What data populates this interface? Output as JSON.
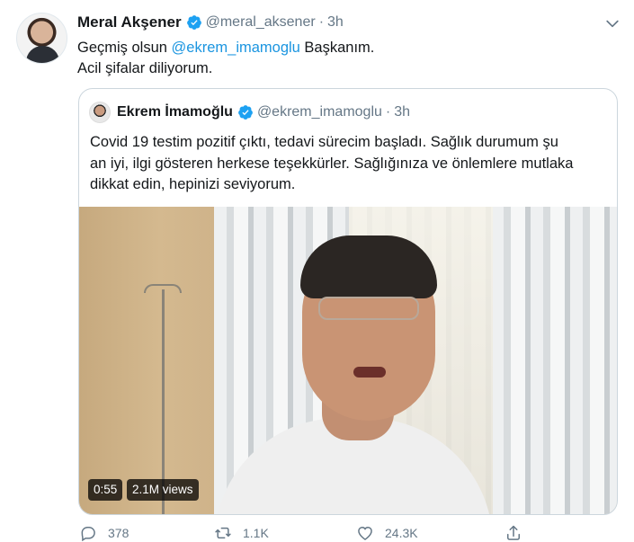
{
  "tweet": {
    "author": {
      "display_name": "Meral Akşener",
      "handle": "@meral_aksener",
      "time": "3h"
    },
    "text_line1_before": "Geçmiş olsun ",
    "text_line1_mention": "@ekrem_imamoglu",
    "text_line1_after": " Başkanım.",
    "text_line2": "Acil şifalar diliyorum."
  },
  "quote": {
    "author": {
      "display_name": "Ekrem İmamoğlu",
      "handle": "@ekrem_imamoglu",
      "time": "3h"
    },
    "text_line1": "Covid 19 testim pozitif çıktı, tedavi sürecim başladı. Sağlık durumum şu",
    "text_line2": "an iyi, ilgi gösteren herkese teşekkürler. Sağlığınıza ve önlemlere mutlaka",
    "text_line3": "dikkat edin, hepinizi seviyorum.",
    "video": {
      "duration": "0:55",
      "views": "2.1M views"
    }
  },
  "actions": {
    "reply_count": "378",
    "retweet_count": "1.1K",
    "like_count": "24.3K"
  },
  "icons": {
    "verified": "verified-badge-icon",
    "more": "chevron-down-icon",
    "reply": "reply-icon",
    "retweet": "retweet-icon",
    "like": "heart-icon",
    "share": "share-icon"
  },
  "colors": {
    "link": "#1b95e0",
    "secondary_text": "#657786",
    "border": "#ccd6dd"
  }
}
